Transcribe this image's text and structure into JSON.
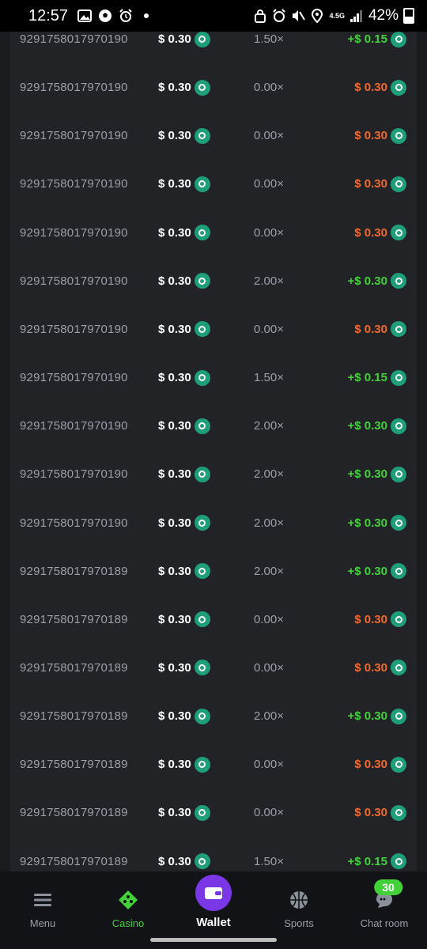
{
  "status_bar": {
    "time": "12:57",
    "network": "4.5G",
    "battery": "42%"
  },
  "colors": {
    "loss": "#f06a2e",
    "win": "#43d13a",
    "coin": "#1e9f7a",
    "wallet_accent": "#7a37e6",
    "nav_active": "#43d13a"
  },
  "rows": [
    {
      "id": "9291758017970190",
      "bet": "$ 0.30",
      "mult": "1.50×",
      "win": "+$ 0.15",
      "result": "win"
    },
    {
      "id": "9291758017970190",
      "bet": "$ 0.30",
      "mult": "0.00×",
      "win": "$ 0.30",
      "result": "loss"
    },
    {
      "id": "9291758017970190",
      "bet": "$ 0.30",
      "mult": "0.00×",
      "win": "$ 0.30",
      "result": "loss"
    },
    {
      "id": "9291758017970190",
      "bet": "$ 0.30",
      "mult": "0.00×",
      "win": "$ 0.30",
      "result": "loss"
    },
    {
      "id": "9291758017970190",
      "bet": "$ 0.30",
      "mult": "0.00×",
      "win": "$ 0.30",
      "result": "loss"
    },
    {
      "id": "9291758017970190",
      "bet": "$ 0.30",
      "mult": "2.00×",
      "win": "+$ 0.30",
      "result": "win"
    },
    {
      "id": "9291758017970190",
      "bet": "$ 0.30",
      "mult": "0.00×",
      "win": "$ 0.30",
      "result": "loss"
    },
    {
      "id": "9291758017970190",
      "bet": "$ 0.30",
      "mult": "1.50×",
      "win": "+$ 0.15",
      "result": "win"
    },
    {
      "id": "9291758017970190",
      "bet": "$ 0.30",
      "mult": "2.00×",
      "win": "+$ 0.30",
      "result": "win"
    },
    {
      "id": "9291758017970190",
      "bet": "$ 0.30",
      "mult": "2.00×",
      "win": "+$ 0.30",
      "result": "win"
    },
    {
      "id": "9291758017970190",
      "bet": "$ 0.30",
      "mult": "2.00×",
      "win": "+$ 0.30",
      "result": "win"
    },
    {
      "id": "9291758017970189",
      "bet": "$ 0.30",
      "mult": "2.00×",
      "win": "+$ 0.30",
      "result": "win"
    },
    {
      "id": "9291758017970189",
      "bet": "$ 0.30",
      "mult": "0.00×",
      "win": "$ 0.30",
      "result": "loss"
    },
    {
      "id": "9291758017970189",
      "bet": "$ 0.30",
      "mult": "0.00×",
      "win": "$ 0.30",
      "result": "loss"
    },
    {
      "id": "9291758017970189",
      "bet": "$ 0.30",
      "mult": "2.00×",
      "win": "+$ 0.30",
      "result": "win"
    },
    {
      "id": "9291758017970189",
      "bet": "$ 0.30",
      "mult": "0.00×",
      "win": "$ 0.30",
      "result": "loss"
    },
    {
      "id": "9291758017970189",
      "bet": "$ 0.30",
      "mult": "0.00×",
      "win": "$ 0.30",
      "result": "loss"
    },
    {
      "id": "9291758017970189",
      "bet": "$ 0.30",
      "mult": "1.50×",
      "win": "+$ 0.15",
      "result": "win"
    }
  ],
  "nav": {
    "menu": {
      "label": "Menu",
      "icon": "hamburger-icon"
    },
    "casino": {
      "label": "Casino",
      "icon": "casino-icon",
      "active": true
    },
    "wallet": {
      "label": "Wallet",
      "icon": "wallet-icon"
    },
    "sports": {
      "label": "Sports",
      "icon": "basketball-icon"
    },
    "chat": {
      "label": "Chat room",
      "icon": "chat-icon",
      "badge": "30"
    }
  }
}
